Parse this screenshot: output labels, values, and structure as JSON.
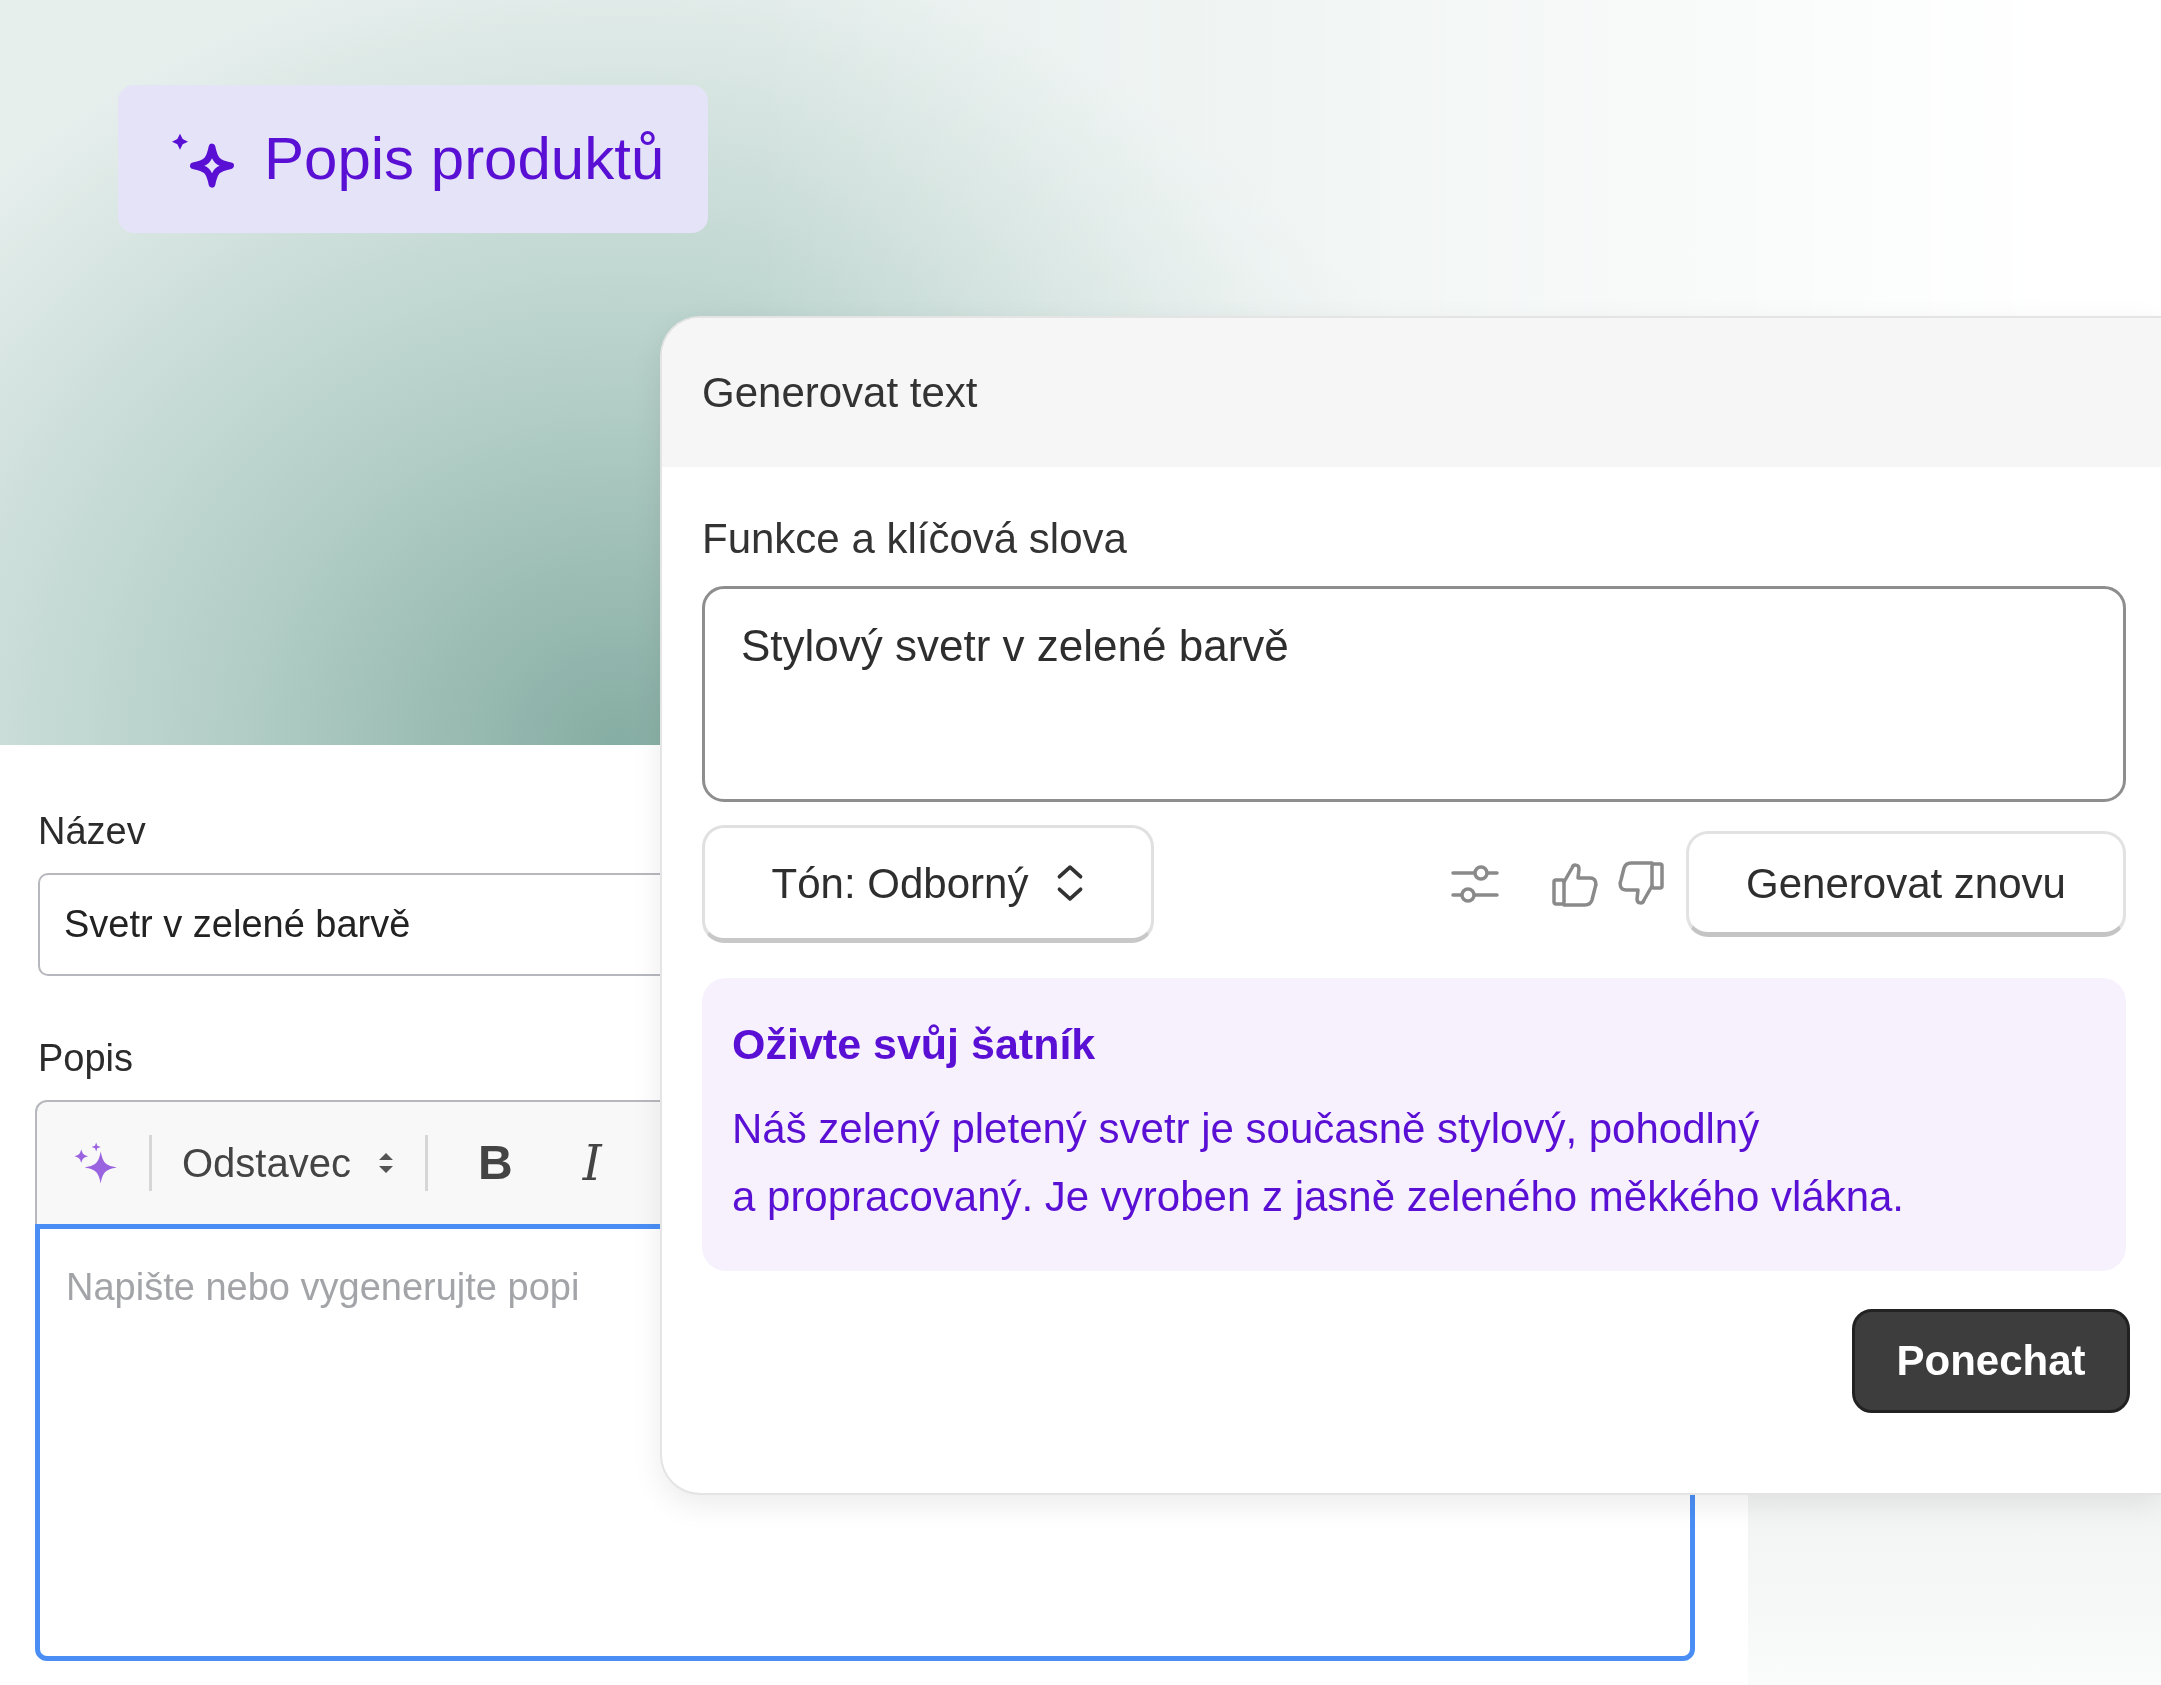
{
  "badge": {
    "title": "Popis produktů"
  },
  "form": {
    "name_field": {
      "label": "Název",
      "value": "Svetr v zelené barvě"
    },
    "description": {
      "label": "Popis",
      "toolbar": {
        "block_style": "Odstavec",
        "bold": "B",
        "italic": "I"
      },
      "placeholder": "Napište nebo vygenerujte popi"
    }
  },
  "generate_panel": {
    "title": "Generovat text",
    "keywords": {
      "label": "Funkce a klíčová slova",
      "value": "Stylový svetr v zelené barvě"
    },
    "tone": "Tón: Odborný",
    "regenerate_button": "Generovat znovu",
    "result": {
      "heading": "Oživte svůj šatník",
      "body": "Náš zelený pletený svetr je současně stylový, pohodlný\na propracovaný. Je vyroben z jasně zeleného měkkého vlákna."
    },
    "keep_button": "Ponechat"
  }
}
